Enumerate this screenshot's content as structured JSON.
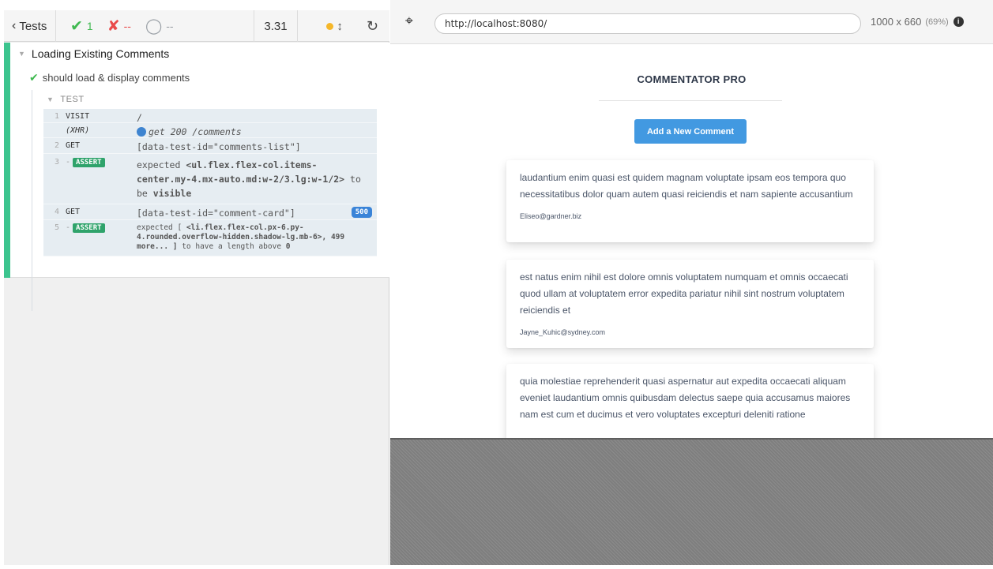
{
  "reporter": {
    "tests_label": "Tests",
    "passed": "1",
    "failed": "--",
    "pending": "--",
    "duration": "3.31",
    "suite_title": "Loading Existing Comments",
    "test_title": "should load & display comments",
    "test_section": "TEST",
    "commands": [
      {
        "num": "1",
        "name": "VISIT",
        "msg": "/"
      },
      {
        "num": "",
        "name": "(XHR)",
        "msg": "get 200 /comments"
      },
      {
        "num": "2",
        "name": "GET",
        "msg": "[data-test-id=\"comments-list\"]"
      },
      {
        "num": "3",
        "name": "ASSERT",
        "msg_prefix": "expected ",
        "msg_code": "<ul.flex.flex-col.items-center.my-4.mx-auto.md:w-2/3.lg:w-1/2>",
        "msg_mid": "to be ",
        "msg_bold": "visible"
      },
      {
        "num": "4",
        "name": "GET",
        "msg": "[data-test-id=\"comment-card\"]",
        "badge": "500"
      },
      {
        "num": "5",
        "name": "ASSERT",
        "msg_prefix": "expected [ ",
        "msg_code": "<li.flex.flex-col.px-6.py-4.rounded.overflow-hidden.shadow-lg.mb-6>, 499 more... ]",
        "msg_mid": " to have a length above ",
        "msg_bold": "0"
      }
    ]
  },
  "aut": {
    "url": "http://localhost:8080/",
    "viewport": "1000 x 660",
    "scale": "(69%)",
    "app_title": "COMMENTATOR PRO",
    "add_button": "Add a New Comment",
    "comments": [
      {
        "text": "laudantium enim quasi est quidem magnam voluptate ipsam eos tempora quo necessitatibus dolor quam autem quasi reiciendis et nam sapiente accusantium",
        "email": "Eliseo@gardner.biz"
      },
      {
        "text": "est natus enim nihil est dolore omnis voluptatem numquam et omnis occaecati quod ullam at voluptatem error expedita pariatur nihil sint nostrum voluptatem reiciendis et",
        "email": "Jayne_Kuhic@sydney.com"
      },
      {
        "text": "quia molestiae reprehenderit quasi aspernatur aut expedita occaecati aliquam eveniet laudantium omnis quibusdam delectus saepe quia accusamus maiores nam est cum et ducimus et vero voluptates excepturi deleniti ratione",
        "email": ""
      }
    ]
  },
  "colors": {
    "pass": "#3fb950",
    "fail": "#e94949",
    "accent": "#4299e1",
    "sidebar_green": "#3cc48e"
  }
}
